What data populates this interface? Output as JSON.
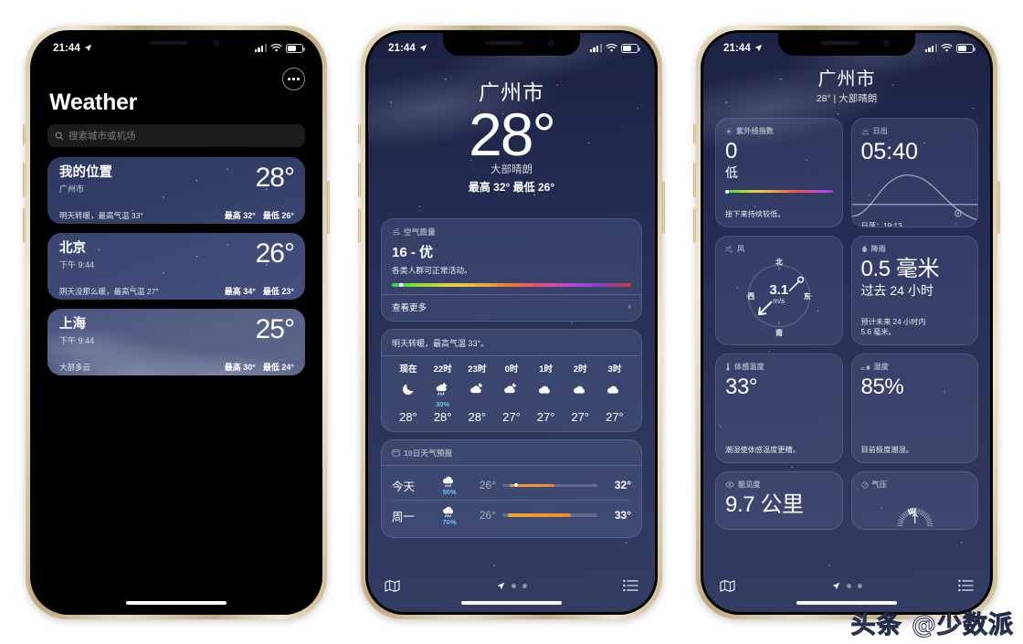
{
  "status_bar": {
    "time": "21:44",
    "location_icon": "location-arrow-icon",
    "battery_level": "62"
  },
  "phone1": {
    "title": "Weather",
    "menu_icon": "ellipsis-circle-icon",
    "search": {
      "placeholder": "搜索城市或机场",
      "icon": "search-icon"
    },
    "cities": [
      {
        "name": "我的位置",
        "sub": "广州市",
        "temp": "28°",
        "desc": "明天转暖，最高气温 33°",
        "hi": "最高 32°",
        "lo": "最低 26°"
      },
      {
        "name": "北京",
        "sub": "下午 9:44",
        "temp": "26°",
        "desc": "阴天没那么暖，最高气温 27°",
        "hi": "最高 34°",
        "lo": "最低 23°"
      },
      {
        "name": "上海",
        "sub": "下午 9:44",
        "temp": "25°",
        "desc": "大部多云",
        "hi": "最高 30°",
        "lo": "最低 24°"
      }
    ]
  },
  "phone2": {
    "city": "广州市",
    "temp": "28°",
    "condition": "大部晴朗",
    "hilo": "最高 32°  最低 26°",
    "air_quality": {
      "head": "空气质量",
      "head_icon": "air-quality-icon",
      "value": "16 - 优",
      "desc": "各类人群可正常活动。",
      "more": "查看更多",
      "chevron_icon": "chevron-right-icon"
    },
    "hourly": {
      "summary": "明天转暖，最高气温 33°。",
      "items": [
        {
          "label": "现在",
          "icon": "moon-icon",
          "pop": "",
          "temp": "28°"
        },
        {
          "label": "22时",
          "icon": "rain-moon-icon",
          "pop": "30%",
          "temp": "28°"
        },
        {
          "label": "23时",
          "icon": "partly-cloudy-moon-icon",
          "pop": "",
          "temp": "28°"
        },
        {
          "label": "0时",
          "icon": "partly-cloudy-moon-icon",
          "pop": "",
          "temp": "27°"
        },
        {
          "label": "1时",
          "icon": "cloud-icon",
          "pop": "",
          "temp": "27°"
        },
        {
          "label": "2时",
          "icon": "cloud-icon",
          "pop": "",
          "temp": "27°"
        },
        {
          "label": "3时",
          "icon": "cloud-icon",
          "pop": "",
          "temp": "27°"
        }
      ]
    },
    "daily": {
      "head": "10日天气预报",
      "head_icon": "calendar-icon",
      "days": [
        {
          "name": "今天",
          "icon": "rain-cloud-icon",
          "pop": "50%",
          "lo": "26°",
          "hi": "32°",
          "bar_start": 8,
          "bar_end": 55,
          "cur": 14
        },
        {
          "name": "周一",
          "icon": "rain-cloud-icon",
          "pop": "70%",
          "lo": "26°",
          "hi": "33°",
          "bar_start": 6,
          "bar_end": 72,
          "cur": -1
        }
      ]
    },
    "tabbar": {
      "map_icon": "map-icon",
      "list_icon": "list-bullet-icon",
      "location_icon": "location-arrow-icon",
      "pages": 3,
      "active_page": 0
    }
  },
  "phone3": {
    "city": "广州市",
    "sub": "28° | 大部晴朗",
    "widgets": [
      {
        "head": "紫外线指数",
        "head_icon": "sun-max-icon",
        "big": "0",
        "sub": "低",
        "foot": "接下来持续较低。",
        "type": "uv"
      },
      {
        "head": "日出",
        "head_icon": "sunrise-icon",
        "big": "05:40",
        "foot": "日落：19:13",
        "type": "sun"
      },
      {
        "head": "风",
        "head_icon": "wind-icon",
        "type": "wind",
        "speed": "3.1",
        "unit": "m/s",
        "compass": {
          "n": "北",
          "s": "南",
          "e": "东",
          "w": "西"
        }
      },
      {
        "head": "降雨",
        "head_icon": "raindrop-icon",
        "big": "0.5 毫米",
        "sub": "过去 24 小时",
        "foot": "预计未来 24 小时内\n5.6 毫米。",
        "type": "rain"
      },
      {
        "head": "体感温度",
        "head_icon": "thermometer-icon",
        "big": "33°",
        "foot": "潮湿使体感温度更糟。",
        "type": "plain"
      },
      {
        "head": "湿度",
        "head_icon": "humidity-icon",
        "big": "85%",
        "foot": "目前极度潮湿。",
        "type": "plain"
      },
      {
        "head": "能见度",
        "head_icon": "eye-icon",
        "big": "9.7 公里",
        "foot": "",
        "type": "plain"
      },
      {
        "head": "气压",
        "head_icon": "gauge-icon",
        "big": "",
        "foot": "",
        "type": "pressure"
      }
    ],
    "tabbar": {
      "map_icon": "map-icon",
      "list_icon": "list-bullet-icon",
      "location_icon": "location-arrow-icon",
      "pages": 3,
      "active_page": 0
    }
  },
  "watermark": "头条 @少数派"
}
